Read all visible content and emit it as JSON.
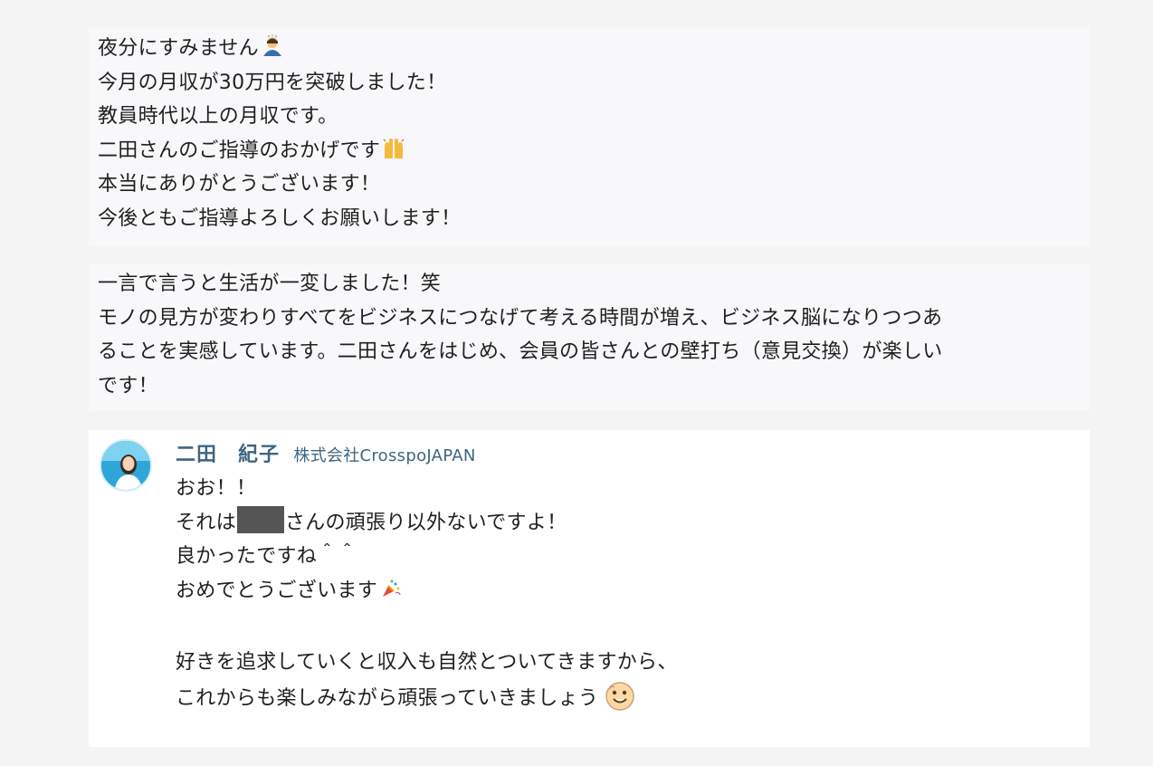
{
  "message1": {
    "lines": [
      "夜分にすみません",
      "今月の月収が30万円を突破しました！",
      "教員時代以上の月収です。",
      "二田さんのご指導のおかげです",
      "本当にありがとうございます！",
      "今後ともご指導よろしくお願いします！"
    ],
    "icons": {
      "line1": "bowing-person-icon",
      "line4": "raising-hands-icon"
    }
  },
  "message2": {
    "lines": [
      "一言で言うと生活が一変しました！笑",
      "モノの見方が変わりすべてをビジネスにつなげて考える時間が増え、ビジネス脳になりつつあ",
      "ることを実感しています。二田さんをはじめ、会員の皆さんとの壁打ち（意見交換）が楽しい",
      "です！"
    ]
  },
  "reply": {
    "author": "二田　紀子",
    "company": "株式会社CrosspoJAPAN",
    "avatar": "author-avatar",
    "lines": [
      "おお！！",
      "それは",
      "さんの頑張り以外ないですよ！",
      "良かったですね＾＾",
      "おめでとうございます",
      "好きを追求していくと収入も自然とついてきますから、",
      "これからも楽しみながら頑張っていきましょう"
    ],
    "icons": {
      "congrats": "party-popper-icon",
      "closing": "smiling-face-icon"
    }
  },
  "colors": {
    "page_background": "#f4f4f5",
    "message_background": "#f8f8fa",
    "reply_background": "#ffffff",
    "author_color": "#3e6580",
    "redaction": "#555555"
  }
}
